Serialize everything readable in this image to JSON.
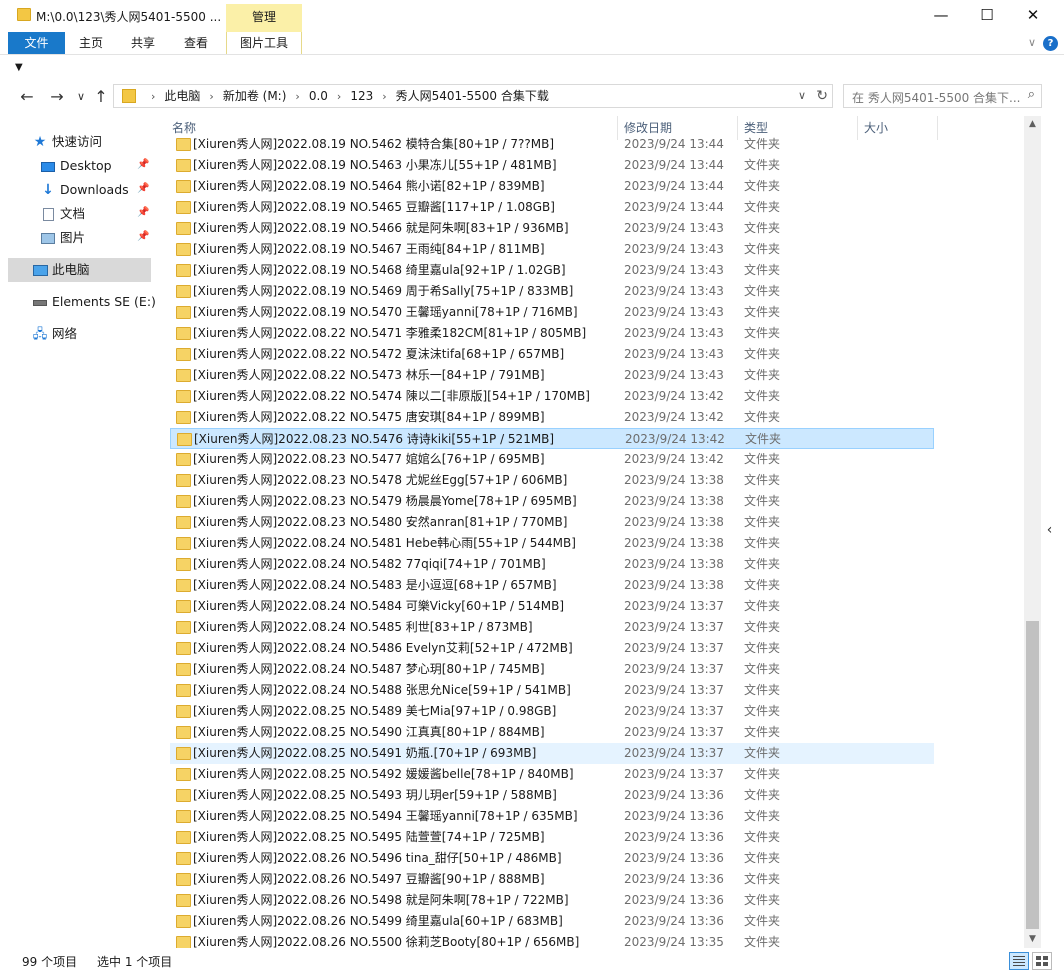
{
  "window": {
    "title": "M:\\0.0\\123\\秀人网5401-5500 ...",
    "context_tab": "管理",
    "minimize": "—",
    "maximize": "☐",
    "close": "✕"
  },
  "ribbon": {
    "tabs": [
      "文件",
      "主页",
      "共享",
      "查看",
      "图片工具"
    ],
    "collapse": "∨",
    "help": "?"
  },
  "qat": {
    "customize": "▼"
  },
  "nav_buttons": {
    "back": "←",
    "forward": "→",
    "recent": "∨",
    "up": "↑"
  },
  "address": {
    "crumbs": [
      "此电脑",
      "新加卷 (M:)",
      "0.0",
      "123",
      "秀人网5401-5500 合集下载"
    ],
    "separator": "›",
    "dropdown": "∨",
    "refresh": "↻"
  },
  "search": {
    "placeholder": "在 秀人网5401-5500 合集下...",
    "icon": "⌕"
  },
  "navpane": {
    "quick_access": "快速访问",
    "items": [
      {
        "label": "Desktop",
        "icon": "desktop-icon",
        "pinned": true
      },
      {
        "label": "Downloads",
        "icon": "download-icon",
        "pinned": true
      },
      {
        "label": "文档",
        "icon": "document-icon",
        "pinned": true
      },
      {
        "label": "图片",
        "icon": "picture-icon",
        "pinned": true
      }
    ],
    "this_pc": "此电脑",
    "drive": "Elements SE (E:)",
    "network": "网络",
    "pin_glyph": "📌"
  },
  "columns": {
    "name": "名称",
    "date": "修改日期",
    "type": "类型",
    "size": "大小",
    "sort_indicator": "^"
  },
  "files": [
    {
      "name": "[Xiuren秀人网]2022.08.19 NO.5462 模特合集[80+1P / 7??MB]",
      "date": "2023/9/24 13:44",
      "type": "文件夹",
      "state": "clipped"
    },
    {
      "name": "[Xiuren秀人网]2022.08.19 NO.5463 小果冻儿[55+1P / 481MB]",
      "date": "2023/9/24 13:44",
      "type": "文件夹"
    },
    {
      "name": "[Xiuren秀人网]2022.08.19 NO.5464 熊小诺[82+1P / 839MB]",
      "date": "2023/9/24 13:44",
      "type": "文件夹"
    },
    {
      "name": "[Xiuren秀人网]2022.08.19 NO.5465 豆瓣酱[117+1P / 1.08GB]",
      "date": "2023/9/24 13:44",
      "type": "文件夹"
    },
    {
      "name": "[Xiuren秀人网]2022.08.19 NO.5466 就是阿朱啊[83+1P / 936MB]",
      "date": "2023/9/24 13:43",
      "type": "文件夹"
    },
    {
      "name": "[Xiuren秀人网]2022.08.19 NO.5467 王雨纯[84+1P / 811MB]",
      "date": "2023/9/24 13:43",
      "type": "文件夹"
    },
    {
      "name": "[Xiuren秀人网]2022.08.19 NO.5468 绮里嘉ula[92+1P / 1.02GB]",
      "date": "2023/9/24 13:43",
      "type": "文件夹"
    },
    {
      "name": "[Xiuren秀人网]2022.08.19 NO.5469 周于希Sally[75+1P / 833MB]",
      "date": "2023/9/24 13:43",
      "type": "文件夹"
    },
    {
      "name": "[Xiuren秀人网]2022.08.19 NO.5470 王馨瑶yanni[78+1P / 716MB]",
      "date": "2023/9/24 13:43",
      "type": "文件夹"
    },
    {
      "name": "[Xiuren秀人网]2022.08.22 NO.5471 李雅柔182CM[81+1P / 805MB]",
      "date": "2023/9/24 13:43",
      "type": "文件夹"
    },
    {
      "name": "[Xiuren秀人网]2022.08.22 NO.5472 夏沫沫tifa[68+1P / 657MB]",
      "date": "2023/9/24 13:43",
      "type": "文件夹"
    },
    {
      "name": "[Xiuren秀人网]2022.08.22 NO.5473 林乐一[84+1P / 791MB]",
      "date": "2023/9/24 13:43",
      "type": "文件夹"
    },
    {
      "name": "[Xiuren秀人网]2022.08.22 NO.5474 陳以二[非原版][54+1P / 170MB]",
      "date": "2023/9/24 13:42",
      "type": "文件夹"
    },
    {
      "name": "[Xiuren秀人网]2022.08.22 NO.5475 唐安琪[84+1P / 899MB]",
      "date": "2023/9/24 13:42",
      "type": "文件夹"
    },
    {
      "name": "[Xiuren秀人网]2022.08.23 NO.5476 诗诗kiki[55+1P / 521MB]",
      "date": "2023/9/24 13:42",
      "type": "文件夹",
      "state": "selected"
    },
    {
      "name": "[Xiuren秀人网]2022.08.23 NO.5477 婠婠么[76+1P / 695MB]",
      "date": "2023/9/24 13:42",
      "type": "文件夹"
    },
    {
      "name": "[Xiuren秀人网]2022.08.23 NO.5478 尤妮丝Egg[57+1P / 606MB]",
      "date": "2023/9/24 13:38",
      "type": "文件夹"
    },
    {
      "name": "[Xiuren秀人网]2022.08.23 NO.5479 杨晨晨Yome[78+1P / 695MB]",
      "date": "2023/9/24 13:38",
      "type": "文件夹"
    },
    {
      "name": "[Xiuren秀人网]2022.08.23 NO.5480 安然anran[81+1P / 770MB]",
      "date": "2023/9/24 13:38",
      "type": "文件夹"
    },
    {
      "name": "[Xiuren秀人网]2022.08.24 NO.5481 Hebe韩心雨[55+1P / 544MB]",
      "date": "2023/9/24 13:38",
      "type": "文件夹"
    },
    {
      "name": "[Xiuren秀人网]2022.08.24 NO.5482 77qiqi[74+1P / 701MB]",
      "date": "2023/9/24 13:38",
      "type": "文件夹"
    },
    {
      "name": "[Xiuren秀人网]2022.08.24 NO.5483 是小逗逗[68+1P / 657MB]",
      "date": "2023/9/24 13:38",
      "type": "文件夹"
    },
    {
      "name": "[Xiuren秀人网]2022.08.24 NO.5484 可樂Vicky[60+1P / 514MB]",
      "date": "2023/9/24 13:37",
      "type": "文件夹"
    },
    {
      "name": "[Xiuren秀人网]2022.08.24 NO.5485 利世[83+1P / 873MB]",
      "date": "2023/9/24 13:37",
      "type": "文件夹"
    },
    {
      "name": "[Xiuren秀人网]2022.08.24 NO.5486 Evelyn艾莉[52+1P / 472MB]",
      "date": "2023/9/24 13:37",
      "type": "文件夹"
    },
    {
      "name": "[Xiuren秀人网]2022.08.24 NO.5487 梦心玥[80+1P / 745MB]",
      "date": "2023/9/24 13:37",
      "type": "文件夹"
    },
    {
      "name": "[Xiuren秀人网]2022.08.24 NO.5488 张思允Nice[59+1P / 541MB]",
      "date": "2023/9/24 13:37",
      "type": "文件夹"
    },
    {
      "name": "[Xiuren秀人网]2022.08.25 NO.5489 美七Mia[97+1P / 0.98GB]",
      "date": "2023/9/24 13:37",
      "type": "文件夹"
    },
    {
      "name": "[Xiuren秀人网]2022.08.25 NO.5490 江真真[80+1P / 884MB]",
      "date": "2023/9/24 13:37",
      "type": "文件夹"
    },
    {
      "name": "[Xiuren秀人网]2022.08.25 NO.5491 奶瓶.[70+1P / 693MB]",
      "date": "2023/9/24 13:37",
      "type": "文件夹",
      "state": "hover"
    },
    {
      "name": "[Xiuren秀人网]2022.08.25 NO.5492 媛媛酱belle[78+1P / 840MB]",
      "date": "2023/9/24 13:37",
      "type": "文件夹"
    },
    {
      "name": "[Xiuren秀人网]2022.08.25 NO.5493 玥儿玥er[59+1P / 588MB]",
      "date": "2023/9/24 13:36",
      "type": "文件夹"
    },
    {
      "name": "[Xiuren秀人网]2022.08.25 NO.5494 王馨瑶yanni[78+1P / 635MB]",
      "date": "2023/9/24 13:36",
      "type": "文件夹"
    },
    {
      "name": "[Xiuren秀人网]2022.08.25 NO.5495 陆萱萱[74+1P / 725MB]",
      "date": "2023/9/24 13:36",
      "type": "文件夹"
    },
    {
      "name": "[Xiuren秀人网]2022.08.26 NO.5496 tina_甜仔[50+1P / 486MB]",
      "date": "2023/9/24 13:36",
      "type": "文件夹"
    },
    {
      "name": "[Xiuren秀人网]2022.08.26 NO.5497 豆瓣酱[90+1P / 888MB]",
      "date": "2023/9/24 13:36",
      "type": "文件夹"
    },
    {
      "name": "[Xiuren秀人网]2022.08.26 NO.5498 就是阿朱啊[78+1P / 722MB]",
      "date": "2023/9/24 13:36",
      "type": "文件夹"
    },
    {
      "name": "[Xiuren秀人网]2022.08.26 NO.5499 绮里嘉ula[60+1P / 683MB]",
      "date": "2023/9/24 13:36",
      "type": "文件夹"
    },
    {
      "name": "[Xiuren秀人网]2022.08.26 NO.5500 徐莉芝Booty[80+1P / 656MB]",
      "date": "2023/9/24 13:35",
      "type": "文件夹"
    }
  ],
  "scrollbar": {
    "up": "▲",
    "down": "▼",
    "side_handle": "‹"
  },
  "status": {
    "count": "99 个项目",
    "selected": "选中 1 个项目"
  }
}
